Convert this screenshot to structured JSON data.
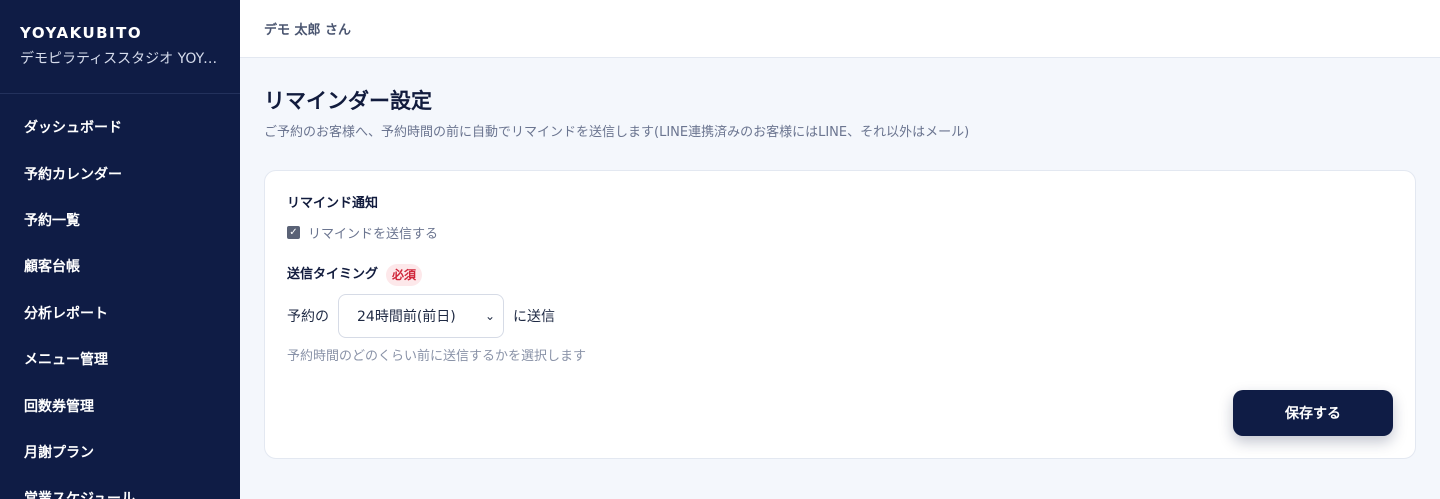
{
  "sidebar": {
    "brand": "YOYAKUBITO",
    "studio": "デモピラティススタジオ YOYAKUBITO",
    "items": [
      {
        "label": "ダッシュボード"
      },
      {
        "label": "予約カレンダー"
      },
      {
        "label": "予約一覧"
      },
      {
        "label": "顧客台帳"
      },
      {
        "label": "分析レポート"
      },
      {
        "label": "メニュー管理"
      },
      {
        "label": "回数券管理"
      },
      {
        "label": "月謝プラン"
      },
      {
        "label": "営業スケジュール"
      }
    ]
  },
  "header": {
    "user": "デモ 太郎 さん"
  },
  "main": {
    "title": "リマインダー設定",
    "description": "ご予約のお客様へ、予約時間の前に自動でリマインドを送信します(LINE連携済みのお客様にはLINE、それ以外はメール)",
    "reminder": {
      "label": "リマインド通知",
      "checkbox_label": "リマインドを送信する",
      "checked": true
    },
    "timing": {
      "label": "送信タイミング",
      "required": "必須",
      "prefix": "予約の",
      "selected": "24時間前(前日)",
      "suffix": "に送信",
      "help": "予約時間のどのくらい前に送信するかを選択します"
    },
    "save_label": "保存する"
  },
  "icons": {
    "checkbox": "check-icon",
    "select": "chevron-down-icon"
  },
  "colors": {
    "sidebar": "#0f1c45",
    "required": "#d0263a",
    "primary_button": "#0f1c45"
  }
}
